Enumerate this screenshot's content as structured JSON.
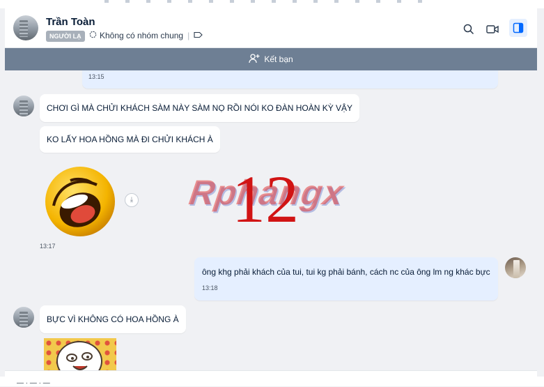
{
  "contact": {
    "name": "Trần Toàn",
    "badge": "NGƯỜI LẠ",
    "group_status": "Không có nhóm chung"
  },
  "add_friend": {
    "label": "Kết bạn"
  },
  "messages": {
    "prev_time": "13:15",
    "m1": "CHƠI GÌ MÀ CHỬI KHÁCH SÀM NÀY SÀM NỌ RỒI NÓI KO ĐÀN HOÀN KỲ VẬY",
    "m2": "KO LẤY HOA HỒNG MÀ ĐI CHỬI KHÁCH À",
    "m2_time": "13:17",
    "me1": "ông khg phải khách của tui, tui kg phải bánh, cách nc của ông lm ng khác bực",
    "me1_time": "13:18",
    "m3": "BỰC VÌ KHÔNG CÓ HOA HỒNG À"
  },
  "overlay": {
    "watermark": "Rphangx",
    "number": "12"
  },
  "colors": {
    "add_friend_bar": "#6e7f94",
    "my_bubble": "#e5efff",
    "badge": "#a8b0ba",
    "overlay_number": "#d11414"
  },
  "icons": [
    "search-icon",
    "video-call-icon",
    "sidebar-toggle-icon",
    "tag-icon",
    "add-user-icon",
    "download-icon",
    "group-icon"
  ]
}
